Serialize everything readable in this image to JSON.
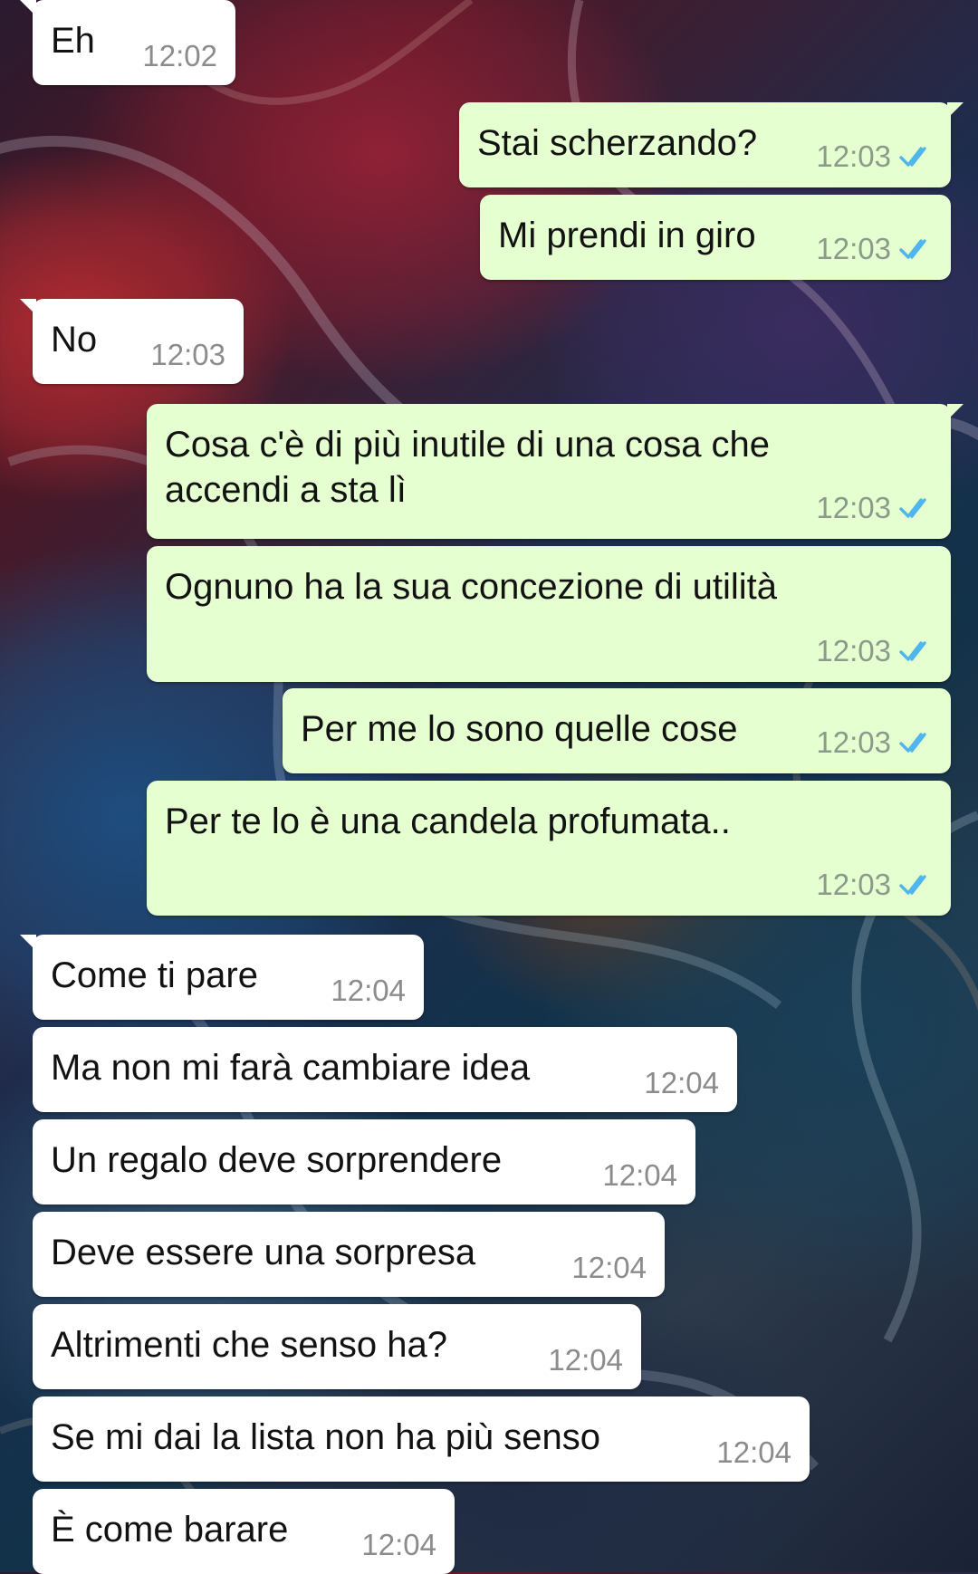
{
  "chat": {
    "messages": [
      {
        "text": "Eh",
        "time": "12:02",
        "direction": "incoming",
        "status": ""
      },
      {
        "text": "Stai scherzando?",
        "time": "12:03",
        "direction": "outgoing",
        "status": "read"
      },
      {
        "text": "Mi prendi in giro",
        "time": "12:03",
        "direction": "outgoing",
        "status": "read"
      },
      {
        "text": "No",
        "time": "12:03",
        "direction": "incoming",
        "status": ""
      },
      {
        "text": "Cosa c'è di più inutile di una cosa che\naccendi a sta lì",
        "time": "12:03",
        "direction": "outgoing",
        "status": "read"
      },
      {
        "text": "Ognuno ha la sua concezione di utilità",
        "time": "12:03",
        "direction": "outgoing",
        "status": "read"
      },
      {
        "text": "Per me lo sono quelle cose",
        "time": "12:03",
        "direction": "outgoing",
        "status": "read"
      },
      {
        "text": "Per te lo è una candela profumata..",
        "time": "12:03",
        "direction": "outgoing",
        "status": "read"
      },
      {
        "text": "Come ti pare",
        "time": "12:04",
        "direction": "incoming",
        "status": ""
      },
      {
        "text": "Ma non mi farà cambiare idea",
        "time": "12:04",
        "direction": "incoming",
        "status": ""
      },
      {
        "text": "Un regalo deve sorprendere",
        "time": "12:04",
        "direction": "incoming",
        "status": ""
      },
      {
        "text": "Deve essere una sorpresa",
        "time": "12:04",
        "direction": "incoming",
        "status": ""
      },
      {
        "text": "Altrimenti che senso ha?",
        "time": "12:04",
        "direction": "incoming",
        "status": ""
      },
      {
        "text": "Se mi dai la lista non ha più senso",
        "time": "12:04",
        "direction": "incoming",
        "status": ""
      },
      {
        "text": "È come barare",
        "time": "12:04",
        "direction": "incoming",
        "status": ""
      }
    ],
    "icons": {
      "read_receipt": "double-check-icon"
    },
    "colors": {
      "incoming_bubble": "#ffffff",
      "outgoing_bubble": "#e6ffd1",
      "timestamp": "#8b9a8b",
      "read_ticks": "#4fb6ec"
    }
  }
}
